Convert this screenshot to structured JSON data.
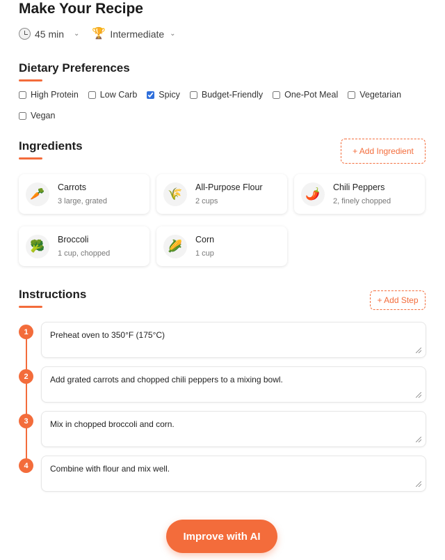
{
  "header": {
    "title": "Make Your Recipe",
    "time_value": "45 min",
    "difficulty_value": "Intermediate",
    "time_icon": "clock-icon",
    "difficulty_icon": "trophy-icon"
  },
  "dietary": {
    "title": "Dietary Preferences",
    "options": [
      {
        "label": "High Protein",
        "checked": false
      },
      {
        "label": "Low Carb",
        "checked": false
      },
      {
        "label": "Spicy",
        "checked": true
      },
      {
        "label": "Budget-Friendly",
        "checked": false
      },
      {
        "label": "One-Pot Meal",
        "checked": false
      },
      {
        "label": "Vegetarian",
        "checked": false
      },
      {
        "label": "Vegan",
        "checked": false
      }
    ]
  },
  "ingredients": {
    "title": "Ingredients",
    "add_label": "+ Add Ingredient",
    "items": [
      {
        "name": "Carrots",
        "qty": "3 large, grated",
        "icon": "🥕"
      },
      {
        "name": "All-Purpose Flour",
        "qty": "2 cups",
        "icon": "🌾"
      },
      {
        "name": "Chili Peppers",
        "qty": "2, finely chopped",
        "icon": "🌶️"
      },
      {
        "name": "Broccoli",
        "qty": "1 cup, chopped",
        "icon": "🥦"
      },
      {
        "name": "Corn",
        "qty": "1 cup",
        "icon": "🌽"
      }
    ]
  },
  "instructions": {
    "title": "Instructions",
    "add_label": "+ Add Step",
    "steps": [
      {
        "num": "1",
        "text": "Preheat oven to 350°F (175°C)"
      },
      {
        "num": "2",
        "text": "Add grated carrots and chopped chili peppers to a mixing bowl."
      },
      {
        "num": "3",
        "text": "Mix in chopped broccoli and corn."
      },
      {
        "num": "4",
        "text": "Combine with flour and mix well."
      }
    ]
  },
  "actions": {
    "improve_label": "Improve with AI"
  },
  "colors": {
    "accent": "#f36c3b",
    "checkbox": "#2f6fdb"
  }
}
